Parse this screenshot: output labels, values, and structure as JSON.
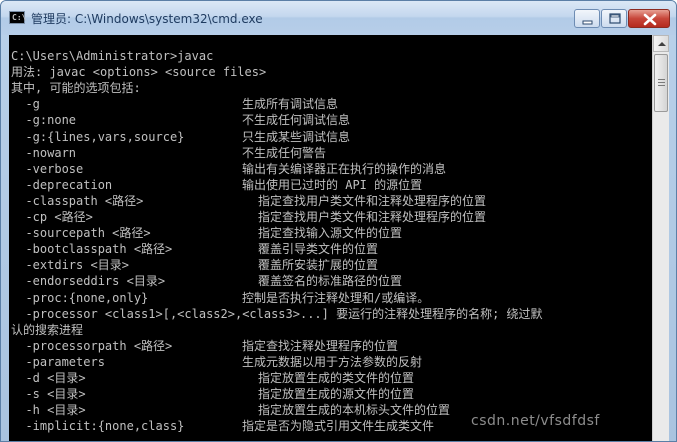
{
  "window": {
    "title": "管理员: C:\\Windows\\system32\\cmd.exe",
    "app_icon_text": "C:\\",
    "controls": [
      "minimize",
      "maximize",
      "close"
    ]
  },
  "console": {
    "lines": [
      "C:\\Users\\Administrator>javac",
      "用法: javac <options> <source files>",
      "其中, 可能的选项包括:",
      "  -g",
      "  -g:none",
      "  -g:{lines,vars,source}",
      "  -nowarn",
      "  -verbose",
      "  -deprecation",
      "  -classpath <路径>",
      "  -cp <路径>",
      "  -sourcepath <路径>",
      "  -bootclasspath <路径>",
      "  -extdirs <目录>",
      "  -endorseddirs <目录>",
      "  -proc:{none,only}",
      "  -processor <class1>[,<class2>,<class3>...] 要运行的注释处理程序的名称; 绕过默",
      "认的搜索进程",
      "  -processorpath <路径>",
      "  -parameters",
      "  -d <目录>",
      "  -s <目录>",
      "  -h <目录>",
      "  -implicit:{none,class}"
    ],
    "descriptions": [
      "",
      "",
      "",
      "生成所有调试信息",
      "不生成任何调试信息",
      "只生成某些调试信息",
      "不生成任何警告",
      "输出有关编译器正在执行的操作的消息",
      "输出使用已过时的 API 的源位置",
      "指定查找用户类文件和注释处理程序的位置",
      "指定查找用户类文件和注释处理程序的位置",
      "指定查找输入源文件的位置",
      "覆盖引导类文件的位置",
      "覆盖所安装扩展的位置",
      "覆盖签名的标准路径的位置",
      "控制是否执行注释处理和/或编译。",
      "",
      "",
      "指定查找注释处理程序的位置",
      "生成元数据以用于方法参数的反射",
      "指定放置生成的类文件的位置",
      "指定放置生成的源文件的位置",
      "指定放置生成的本机标头文件的位置",
      "指定是否为隐式引用文件生成类文件"
    ]
  },
  "watermark": "csdn.net/vfsdfdsf",
  "colors": {
    "console_bg": "#000000",
    "console_text": "#c0c0c0",
    "close_button": "#c7463a",
    "titlebar": "#c4d7ee"
  }
}
